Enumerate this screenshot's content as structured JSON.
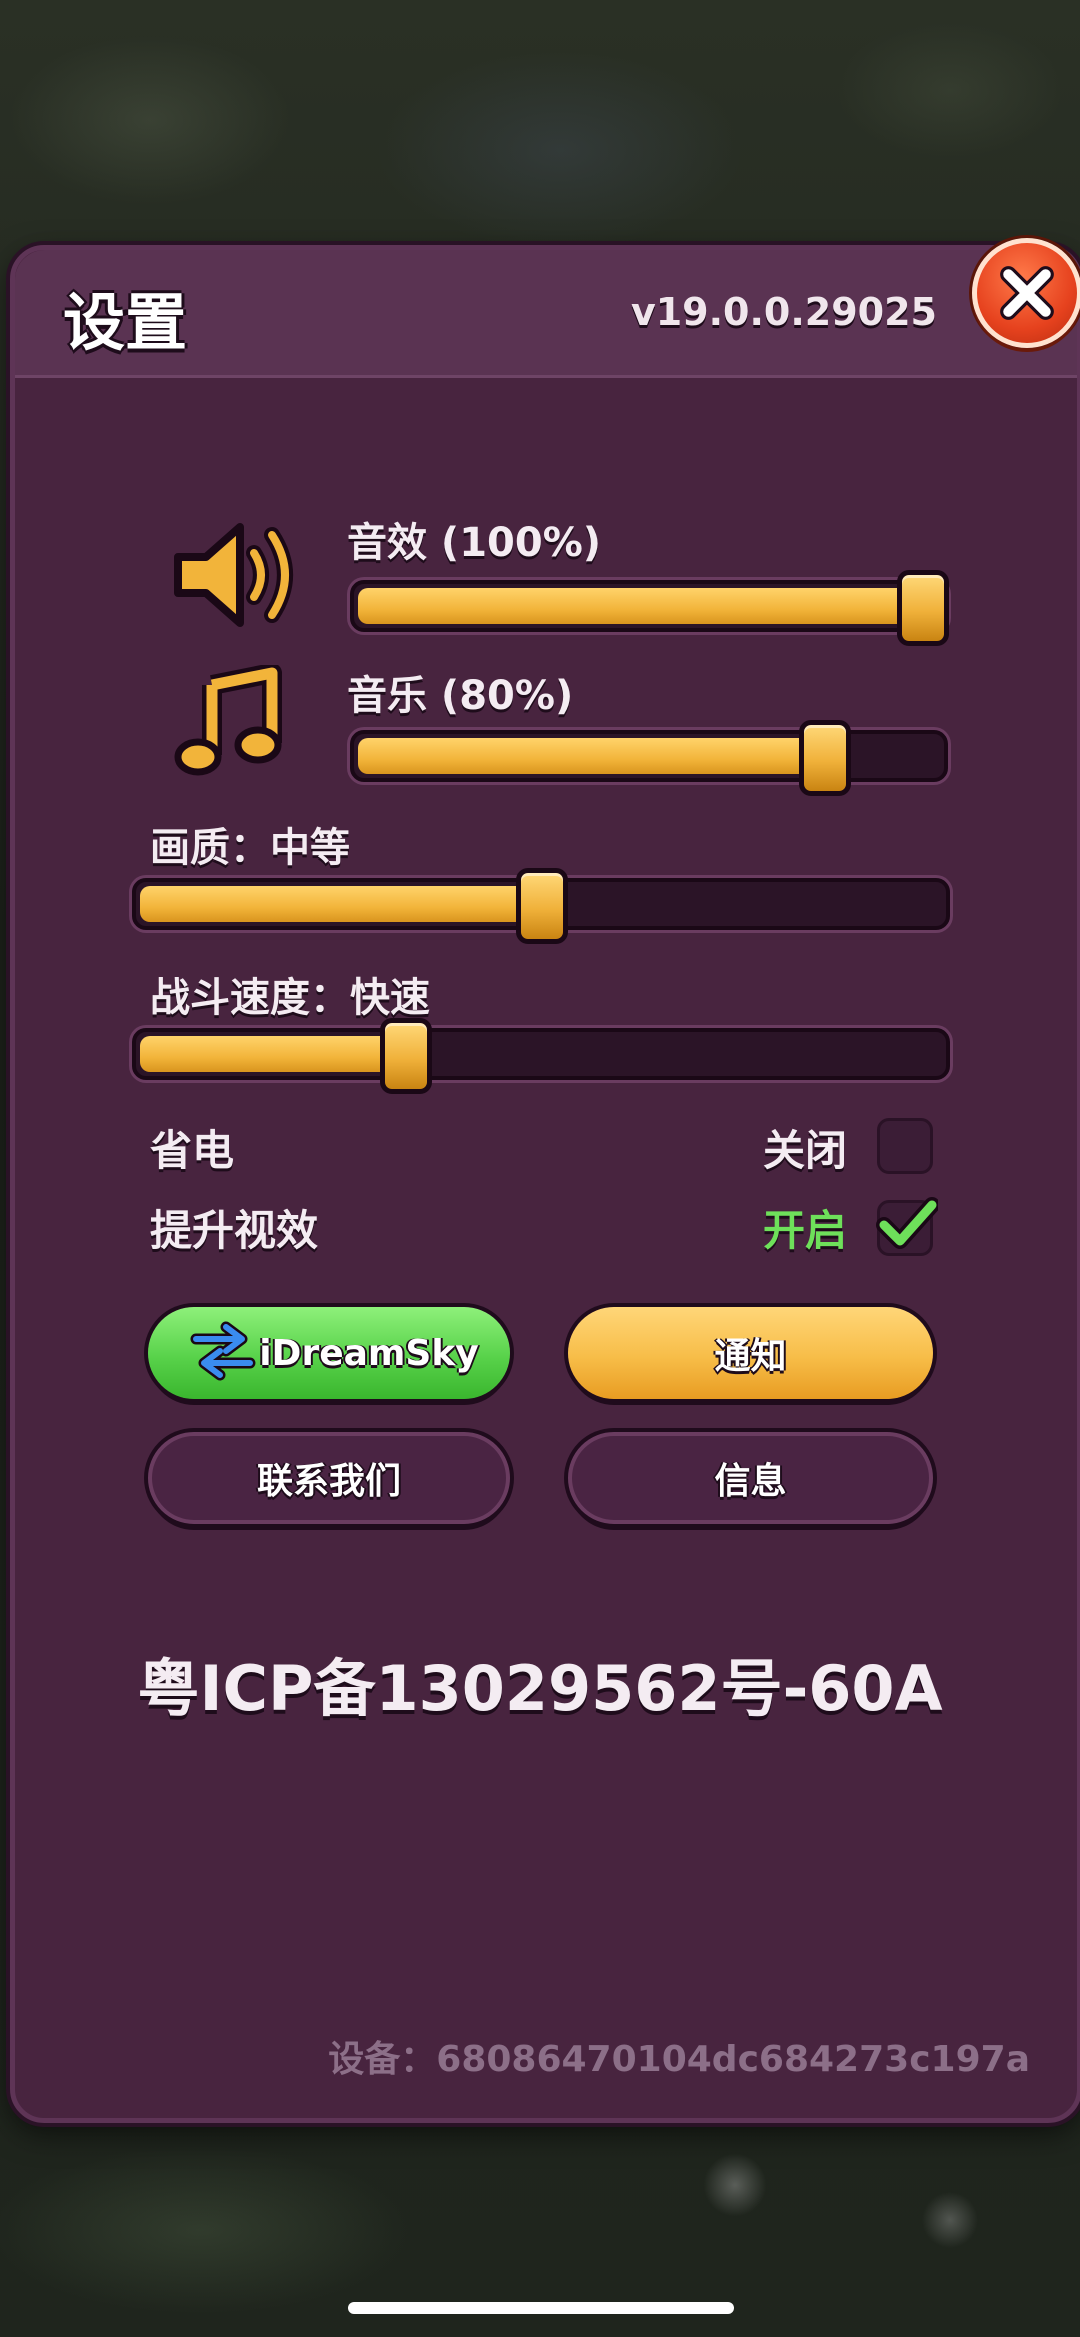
{
  "header": {
    "title": "设置",
    "version": "v19.0.0.29025"
  },
  "icons": {
    "close": "close-icon",
    "sound": "speaker-icon",
    "music": "music-note-icon",
    "swap": "swap-arrows-icon",
    "check": "checkmark-icon"
  },
  "sliders": {
    "sound": {
      "label": "音效 (100%)",
      "value": 1.0
    },
    "music": {
      "label": "音乐 (80%)",
      "value": 0.8
    },
    "quality": {
      "label": "画质：中等",
      "value": 0.5
    },
    "battle_speed": {
      "label": "战斗速度：快速",
      "value": 0.33
    }
  },
  "toggles": {
    "power_saving": {
      "label": "省电",
      "state_text": "关闭",
      "checked": false
    },
    "enhance_effects": {
      "label": "提升视效",
      "state_text": "开启",
      "checked": true
    }
  },
  "buttons": {
    "idreamsky": "iDreamSky",
    "notice": "通知",
    "contact": "联系我们",
    "info": "信息"
  },
  "footer": {
    "icp": "粤ICP备13029562号-60A",
    "device": "设备：68086470104dc684273c197a"
  },
  "colors": {
    "panel": "#48243f",
    "slider_fill": "#f2b43a",
    "on_green": "#6ee05a",
    "close_red": "#e6421e"
  }
}
